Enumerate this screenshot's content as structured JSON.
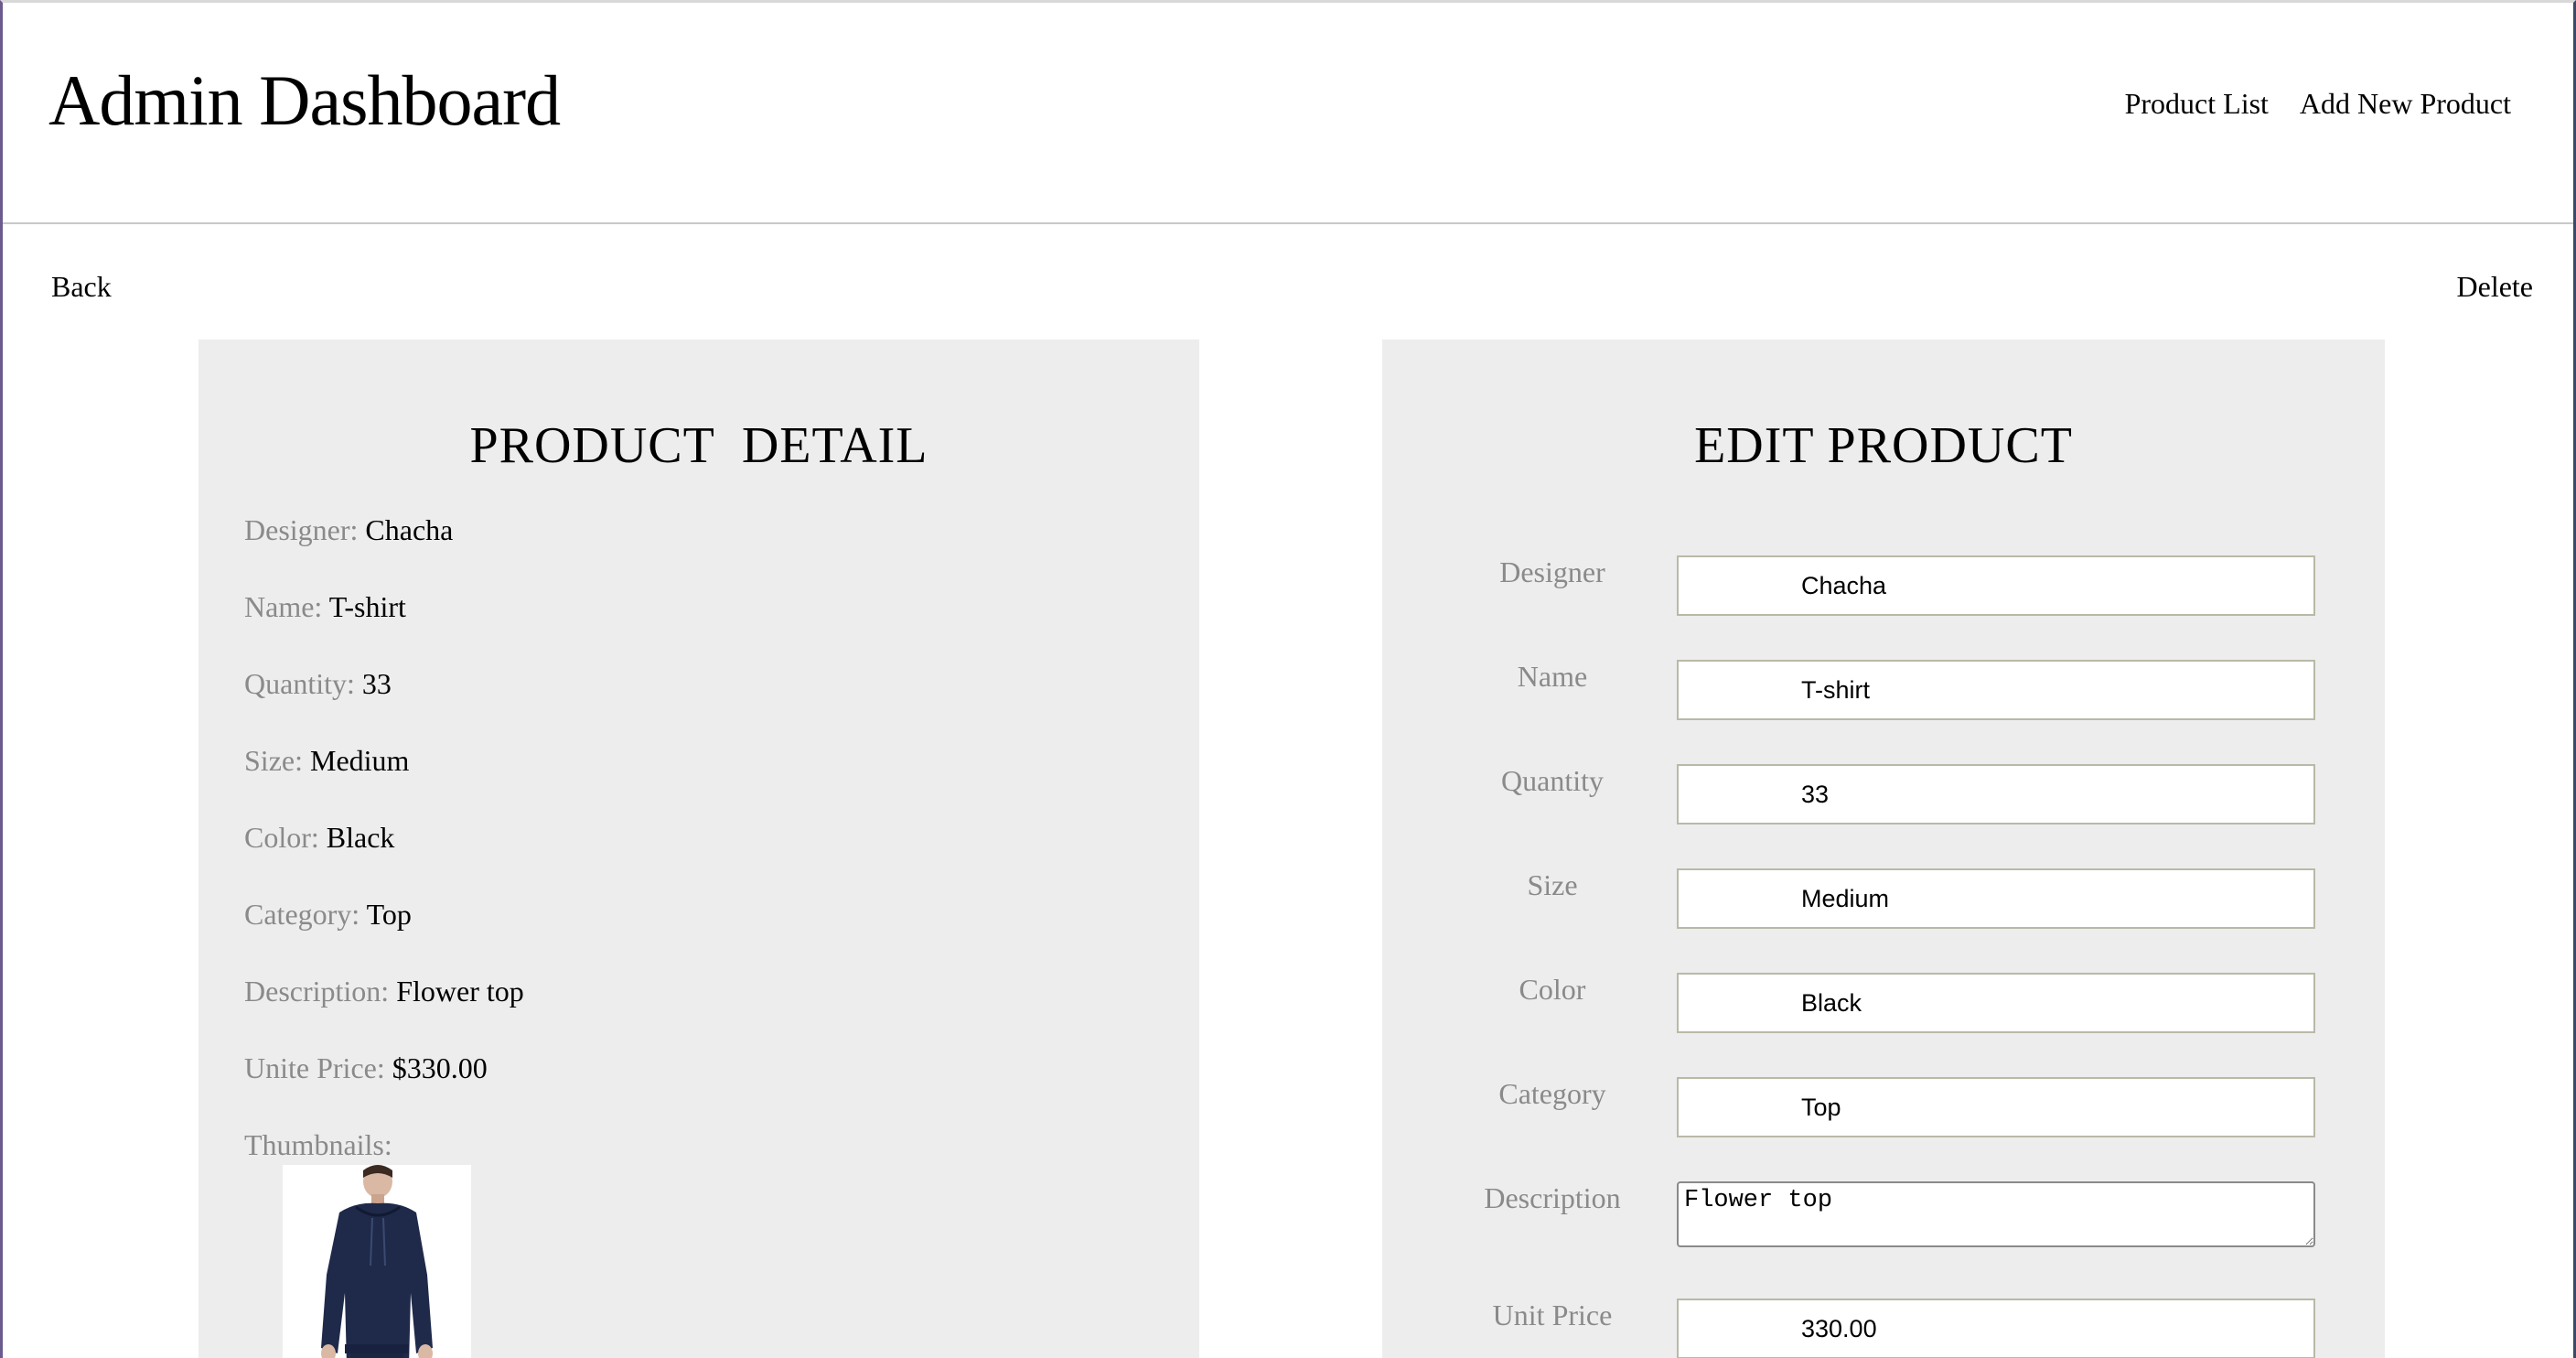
{
  "header": {
    "title": "Admin Dashboard",
    "nav": [
      {
        "label": "Product List"
      },
      {
        "label": "Add New Product"
      }
    ]
  },
  "actions": {
    "back_label": "Back",
    "delete_label": "Delete"
  },
  "detail": {
    "heading": "PRODUCT  DETAIL",
    "rows": [
      {
        "key": "Designer:",
        "value": "Chacha"
      },
      {
        "key": "Name:",
        "value": "T-shirt"
      },
      {
        "key": "Quantity:",
        "value": "33"
      },
      {
        "key": "Size:",
        "value": "Medium"
      },
      {
        "key": "Color:",
        "value": "Black"
      },
      {
        "key": "Category:",
        "value": "Top"
      },
      {
        "key": "Description:",
        "value": "Flower top"
      },
      {
        "key": "Unite Price:",
        "value": "$330.00"
      }
    ],
    "thumbnails_label": "Thumbnails:"
  },
  "edit": {
    "heading": "EDIT PRODUCT",
    "fields": [
      {
        "label": "Designer",
        "value": "Chacha"
      },
      {
        "label": "Name",
        "value": "T-shirt"
      },
      {
        "label": "Quantity",
        "value": "33"
      },
      {
        "label": "Size",
        "value": "Medium"
      },
      {
        "label": "Color",
        "value": "Black"
      },
      {
        "label": "Category",
        "value": "Top"
      },
      {
        "label": "Description",
        "value": "Flower top"
      },
      {
        "label": "Unit Price",
        "value": "330.00"
      }
    ]
  }
}
